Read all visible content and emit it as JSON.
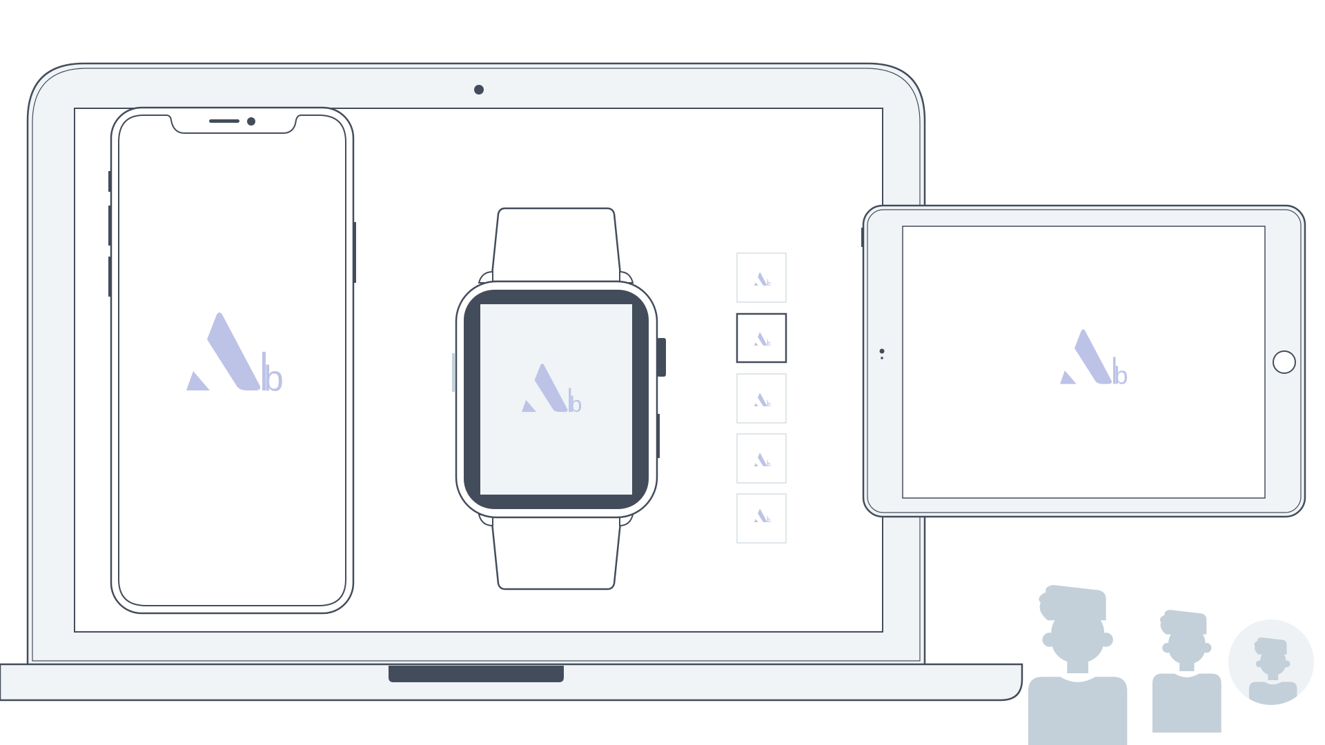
{
  "app": {
    "logo_mark": "Ab"
  },
  "colors": {
    "outline": "#434c5a",
    "bezel": "#f0f4f7",
    "screen": "#ffffff",
    "brand": "#bdc3e6",
    "avatar": "#c3d0d9",
    "avatar_circle_bg": "#eef2f5"
  },
  "devices": {
    "laptop": {
      "icon": "laptop-icon"
    },
    "phone": {
      "icon": "smartphone-icon"
    },
    "watch": {
      "icon": "smartwatch-icon"
    },
    "tablet": {
      "icon": "tablet-icon"
    }
  },
  "thumbnails": {
    "count": 5,
    "selected_index": 1,
    "icon": "app-logo-icon"
  },
  "avatars": [
    {
      "name": "avatar-large",
      "icon": "user-silhouette-icon"
    },
    {
      "name": "avatar-medium",
      "icon": "user-silhouette-icon"
    },
    {
      "name": "avatar-circle",
      "icon": "user-silhouette-icon"
    }
  ]
}
